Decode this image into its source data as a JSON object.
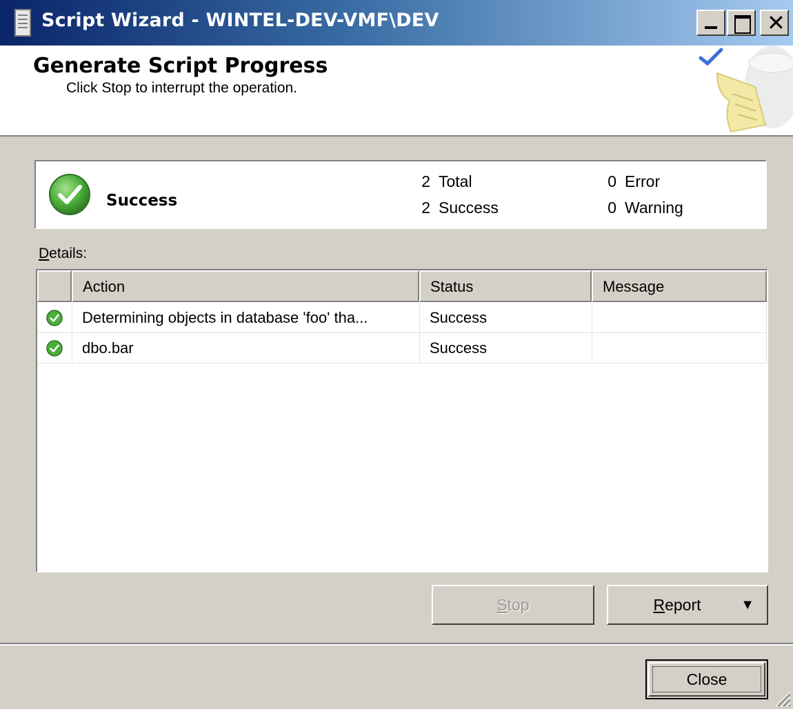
{
  "window": {
    "title": "Script Wizard - WINTEL-DEV-VMF\\DEV",
    "controls": {
      "minimize": "minimize",
      "maximize": "maximize",
      "close": "✕"
    }
  },
  "header": {
    "title": "Generate Script Progress",
    "subtitle": "Click Stop to interrupt the operation."
  },
  "summary": {
    "status": "Success",
    "total": {
      "count": "2",
      "label": "Total"
    },
    "success": {
      "count": "2",
      "label": "Success"
    },
    "error": {
      "count": "0",
      "label": "Error"
    },
    "warning": {
      "count": "0",
      "label": "Warning"
    }
  },
  "details": {
    "label_accel": "D",
    "label_rest": "etails:",
    "columns": [
      "Action",
      "Status",
      "Message"
    ],
    "rows": [
      {
        "action": "Determining objects in database 'foo' tha...",
        "status": "Success",
        "message": "",
        "icon": "success-check-icon"
      },
      {
        "action": "dbo.bar",
        "status": "Success",
        "message": "",
        "icon": "success-check-icon"
      }
    ]
  },
  "buttons": {
    "stop_accel": "S",
    "stop_rest": "top",
    "report_accel": "R",
    "report_rest": "eport",
    "report_arrow": "▼",
    "close": "Close"
  },
  "colors": {
    "title_gradient_start": "#0a246a",
    "title_gradient_end": "#a6caf0",
    "dialog_bg": "#d4d0c8",
    "success_green": "#4caf3a"
  }
}
